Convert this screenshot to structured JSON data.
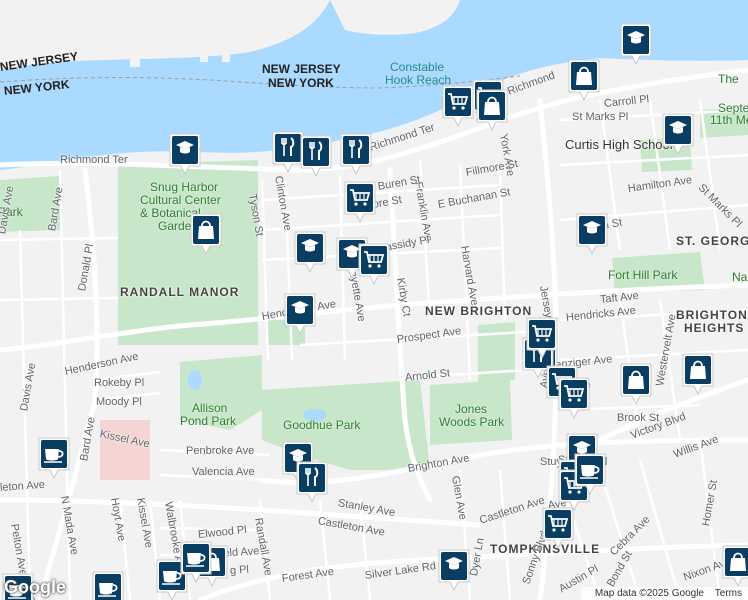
{
  "map": {
    "colors": {
      "water": "#aadaff",
      "park": "#c8e6c9",
      "land": "#f2f2f2",
      "road": "#ffffff",
      "marker": "#0a3d62",
      "hospital": "#f6c7c7"
    },
    "labels": [
      {
        "id": "nj",
        "text": "NEW JERSEY",
        "cls": "state"
      },
      {
        "id": "ny",
        "text": "NEW YORK",
        "cls": "state"
      },
      {
        "id": "nj2",
        "text": "NEW JERSEY",
        "cls": "state"
      },
      {
        "id": "ny2",
        "text": "NEW YORK",
        "cls": "state"
      },
      {
        "id": "constable",
        "text": "Constable",
        "cls": "water"
      },
      {
        "id": "hook",
        "text": "Hook Reach",
        "cls": "water"
      },
      {
        "id": "richmond-ter",
        "text": "Richmond Ter"
      },
      {
        "id": "richmond-ter2",
        "text": "Richmond Ter"
      },
      {
        "id": "richmond",
        "text": "Richmond"
      },
      {
        "id": "snug",
        "text": "Snug Harbor",
        "cls": "park"
      },
      {
        "id": "cultural",
        "text": "Cultural Center",
        "cls": "park"
      },
      {
        "id": "botanical",
        "text": "& Botanical",
        "cls": "park"
      },
      {
        "id": "garden",
        "text": "Garden",
        "cls": "park"
      },
      {
        "id": "park-left",
        "text": "Park",
        "cls": "park"
      },
      {
        "id": "randall",
        "text": "RANDALL MANOR",
        "cls": "area"
      },
      {
        "id": "new-brighton",
        "text": "NEW BRIGHTON",
        "cls": "area"
      },
      {
        "id": "brighton-heights",
        "text": "BRIGHTON",
        "cls": "area"
      },
      {
        "id": "heights",
        "text": "HEIGHTS",
        "cls": "area"
      },
      {
        "id": "st-george",
        "text": "ST. GEORGE",
        "cls": "area"
      },
      {
        "id": "tompkinsville",
        "text": "TOMPKINSVILLE",
        "cls": "area"
      },
      {
        "id": "curtis",
        "text": "Curtis High School",
        "cls": "school"
      },
      {
        "id": "fort-hill",
        "text": "Fort Hill Park",
        "cls": "park"
      },
      {
        "id": "allison",
        "text": "Allison",
        "cls": "park"
      },
      {
        "id": "allison2",
        "text": "Pond Park",
        "cls": "park"
      },
      {
        "id": "goodhue",
        "text": "Goodhue Park",
        "cls": "park"
      },
      {
        "id": "jones",
        "text": "Jones",
        "cls": "park"
      },
      {
        "id": "jones2",
        "text": "Woods Park",
        "cls": "park"
      },
      {
        "id": "na",
        "text": "Na",
        "cls": "park"
      },
      {
        "id": "sept",
        "text": "Septe",
        "cls": "park"
      },
      {
        "id": "11th",
        "text": "11th Me",
        "cls": "park"
      },
      {
        "id": "the",
        "text": "The",
        "cls": "park"
      },
      {
        "id": "henderson",
        "text": "Henderson Ave"
      },
      {
        "id": "henderson2",
        "text": "Henderson Ave"
      },
      {
        "id": "prospect",
        "text": "Prospect Ave"
      },
      {
        "id": "arnold",
        "text": "Arnold St"
      },
      {
        "id": "brighton-ave",
        "text": "Brighton Ave"
      },
      {
        "id": "castleton",
        "text": "Castleton Ave"
      },
      {
        "id": "castleton2",
        "text": "Castleton Ave"
      },
      {
        "id": "stanley",
        "text": "Stanley Ave"
      },
      {
        "id": "forest",
        "text": "Forest Ave"
      },
      {
        "id": "silver",
        "text": "Silver Lake Rd"
      },
      {
        "id": "bard",
        "text": "Bard Ave"
      },
      {
        "id": "bard2",
        "text": "Bard Ave"
      },
      {
        "id": "davis",
        "text": "Davis Ave"
      },
      {
        "id": "davis2",
        "text": "Davis Ave"
      },
      {
        "id": "donald",
        "text": "Donald Pl"
      },
      {
        "id": "rokeby",
        "text": "Rokeby Pl"
      },
      {
        "id": "moody",
        "text": "Moody Pl"
      },
      {
        "id": "kissel",
        "text": "Kissel Ave"
      },
      {
        "id": "kissel2",
        "text": "Kissel Ave"
      },
      {
        "id": "penbroke",
        "text": "Penbroke Ave"
      },
      {
        "id": "valencia",
        "text": "Valencia Ave"
      },
      {
        "id": "elwood",
        "text": "Elwood Pl"
      },
      {
        "id": "randall-ave",
        "text": "Randall Ave"
      },
      {
        "id": "hoyt",
        "text": "Hoyt Ave"
      },
      {
        "id": "nmada",
        "text": "N Mada Ave"
      },
      {
        "id": "pelton",
        "text": "Pelton Ave"
      },
      {
        "id": "walbrooke",
        "text": "Walbrooke Ave"
      },
      {
        "id": "tyson",
        "text": "Tyson St"
      },
      {
        "id": "clinton",
        "text": "Clinton Ave"
      },
      {
        "id": "lafayette",
        "text": "Lafayette Ave"
      },
      {
        "id": "kirby",
        "text": "Kirby Ct"
      },
      {
        "id": "franklin",
        "text": "Franklin Ave"
      },
      {
        "id": "harvard",
        "text": "Harvard Ave"
      },
      {
        "id": "york",
        "text": "York Ave"
      },
      {
        "id": "buren",
        "text": "Buren St"
      },
      {
        "id": "fillmore",
        "text": "Fillmore St"
      },
      {
        "id": "fillmore2",
        "text": "Fillmore St"
      },
      {
        "id": "buchanan",
        "text": "E Buchanan St"
      },
      {
        "id": "cassidy",
        "text": "Cassidy Pl"
      },
      {
        "id": "taft",
        "text": "Taft Ave"
      },
      {
        "id": "hendricks",
        "text": "Hendricks Ave"
      },
      {
        "id": "benziger",
        "text": "Benziger Ave"
      },
      {
        "id": "tysen",
        "text": "Tysen St"
      },
      {
        "id": "hamilton",
        "text": "Hamilton Ave"
      },
      {
        "id": "st-marks",
        "text": "St Marks Pl"
      },
      {
        "id": "st-marks2",
        "text": "St Marks Pl"
      },
      {
        "id": "carroll",
        "text": "Carroll Pl"
      },
      {
        "id": "jersey",
        "text": "Jersey St"
      },
      {
        "id": "stuyvesant",
        "text": "Stuyvesant Pl"
      },
      {
        "id": "brook",
        "text": "Brook St"
      },
      {
        "id": "victory",
        "text": "Victory Blvd"
      },
      {
        "id": "willis",
        "text": "Willis Ave"
      },
      {
        "id": "westervelt",
        "text": "Westervelt Ave"
      },
      {
        "id": "glen",
        "text": "Glen Ave"
      },
      {
        "id": "cebra",
        "text": "Cebra Ave"
      },
      {
        "id": "homer",
        "text": "Homer St"
      },
      {
        "id": "nixon",
        "text": "Nixon Ave"
      },
      {
        "id": "austin",
        "text": "Austin Pl"
      },
      {
        "id": "dyer",
        "text": "Dyer Ln"
      },
      {
        "id": "sonny",
        "text": "Sonny Blvd"
      },
      {
        "id": "bond",
        "text": "Bond St"
      },
      {
        "id": "regan",
        "text": "Reg"
      },
      {
        "id": "leton",
        "text": "leton Ave"
      },
      {
        "id": "ave-frag",
        "text": "Ave"
      },
      {
        "id": "erside",
        "text": "er Ave"
      },
      {
        "id": "gpl",
        "text": "g Pl"
      },
      {
        "id": "field",
        "text": "field Ave"
      },
      {
        "id": "stanley-frag",
        "text": "Stan"
      },
      {
        "id": "ave-frag2",
        "text": "Ave"
      }
    ],
    "markers": [
      {
        "type": "school"
      },
      {
        "type": "school"
      },
      {
        "type": "school"
      },
      {
        "type": "school"
      },
      {
        "type": "school"
      },
      {
        "type": "school"
      },
      {
        "type": "school"
      },
      {
        "type": "school"
      },
      {
        "type": "school"
      },
      {
        "type": "school"
      },
      {
        "type": "restaurant"
      },
      {
        "type": "restaurant"
      },
      {
        "type": "restaurant"
      },
      {
        "type": "restaurant"
      },
      {
        "type": "restaurant"
      },
      {
        "type": "restaurant"
      },
      {
        "type": "grocery"
      },
      {
        "type": "grocery"
      },
      {
        "type": "grocery"
      },
      {
        "type": "grocery"
      },
      {
        "type": "grocery"
      },
      {
        "type": "grocery"
      },
      {
        "type": "grocery"
      },
      {
        "type": "grocery"
      },
      {
        "type": "grocery"
      },
      {
        "type": "grocery"
      },
      {
        "type": "shopping"
      },
      {
        "type": "shopping"
      },
      {
        "type": "shopping"
      },
      {
        "type": "shopping"
      },
      {
        "type": "shopping"
      },
      {
        "type": "shopping"
      },
      {
        "type": "shopping"
      },
      {
        "type": "cafe"
      },
      {
        "type": "cafe"
      },
      {
        "type": "cafe"
      },
      {
        "type": "cafe"
      },
      {
        "type": "cafe"
      },
      {
        "type": "cafe"
      }
    ],
    "footer": {
      "logo": "Google",
      "copyright": "Map data ©2025 Google",
      "terms": "Terms"
    }
  }
}
